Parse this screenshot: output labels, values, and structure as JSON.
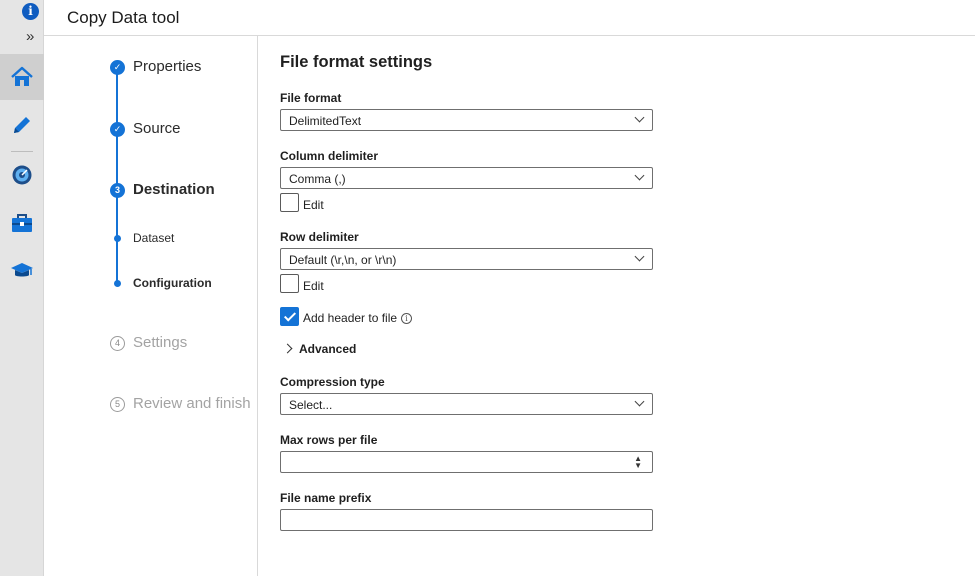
{
  "app": {
    "title": "Copy Data tool"
  },
  "rail": {
    "icons": [
      "info-icon",
      "expand-icon",
      "home-icon",
      "pencil-icon",
      "monitor-icon",
      "toolbox-icon",
      "learn-icon"
    ],
    "active_color": "#1473d6"
  },
  "steps": [
    {
      "number": "✓",
      "label": "Properties",
      "state": "done"
    },
    {
      "number": "✓",
      "label": "Source",
      "state": "done"
    },
    {
      "number": "3",
      "label": "Destination",
      "state": "current"
    },
    {
      "number": "",
      "label": "Dataset",
      "state": "sub"
    },
    {
      "number": "",
      "label": "Configuration",
      "state": "sub-current"
    },
    {
      "number": "4",
      "label": "Settings",
      "state": "future"
    },
    {
      "number": "5",
      "label": "Review and finish",
      "state": "future"
    }
  ],
  "form": {
    "title": "File format settings",
    "file_format": {
      "label": "File format",
      "value": "DelimitedText"
    },
    "column_delimiter": {
      "label": "Column delimiter",
      "value": "Comma (,)",
      "edit_label": "Edit",
      "edit_checked": false
    },
    "row_delimiter": {
      "label": "Row delimiter",
      "value": "Default (\\r,\\n, or \\r\\n)",
      "edit_label": "Edit",
      "edit_checked": false
    },
    "add_header": {
      "label": "Add header to file",
      "checked": true
    },
    "advanced": {
      "label": "Advanced"
    },
    "compression": {
      "label": "Compression type",
      "placeholder": "Select..."
    },
    "max_rows": {
      "label": "Max rows per file",
      "value": ""
    },
    "prefix": {
      "label": "File name prefix",
      "value": ""
    }
  }
}
